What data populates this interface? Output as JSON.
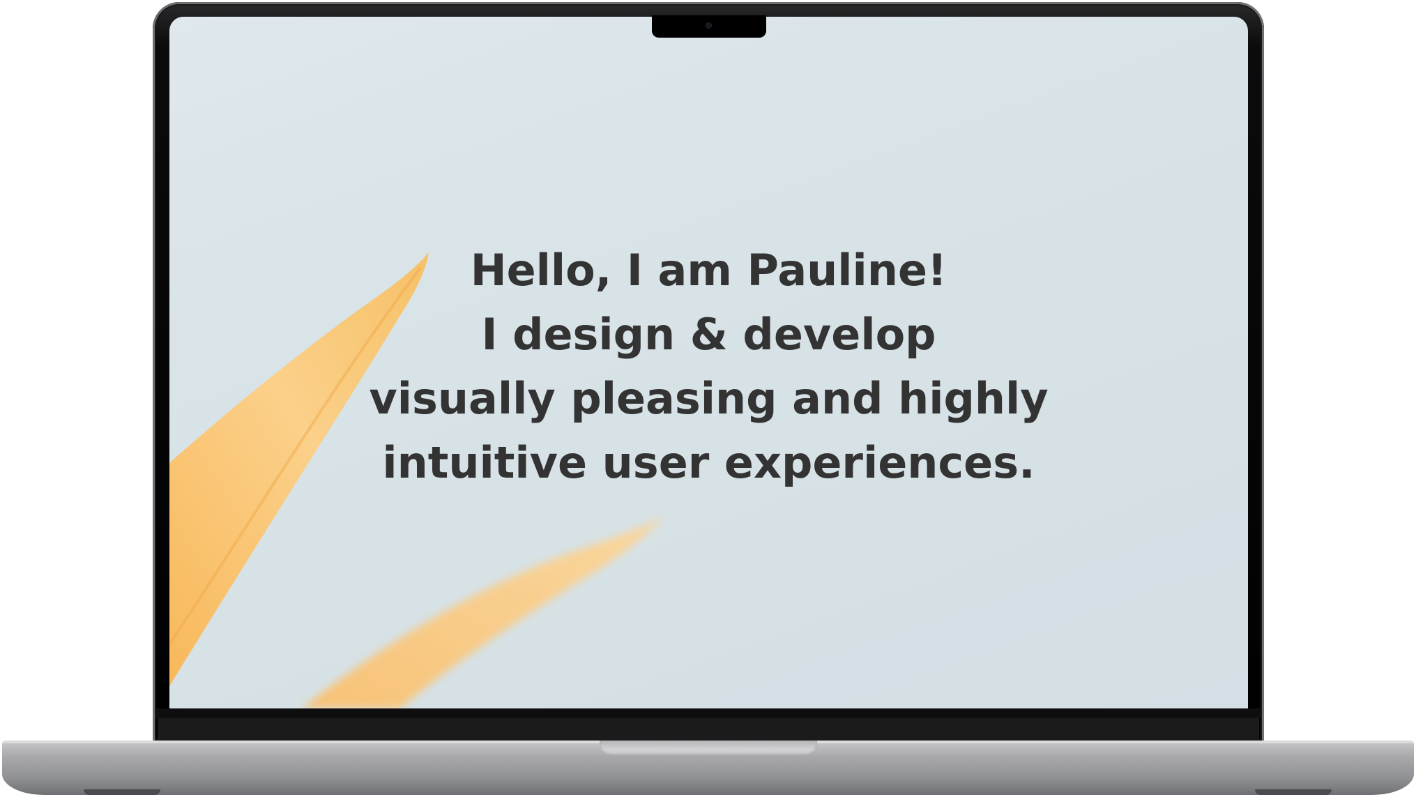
{
  "hero": {
    "lines": [
      "Hello, I am Pauline!",
      "I design & develop",
      "visually pleasing and highly",
      "intuitive user experiences."
    ]
  },
  "colors": {
    "screen_background": "#d8e3e7",
    "text": "#333333",
    "leaf": "#f7c46a",
    "bezel": "#000000",
    "chassis": "#a8a8ab"
  },
  "icons": {
    "camera": "webcam-icon"
  }
}
